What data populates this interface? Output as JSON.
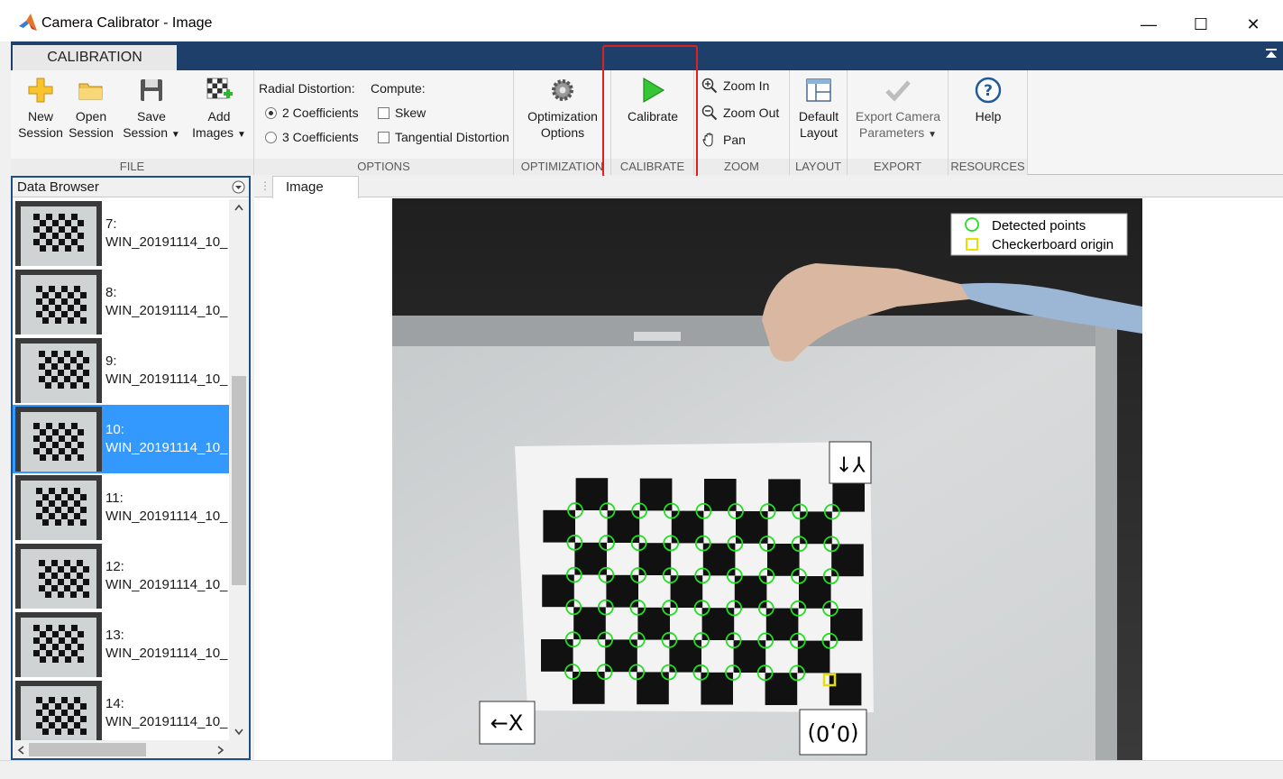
{
  "window": {
    "title": "Camera Calibrator - Image",
    "minimize_glyph": "—",
    "maximize_glyph": "☐",
    "close_glyph": "✕"
  },
  "ribbon": {
    "tab": "CALIBRATION",
    "file": {
      "new_line1": "New",
      "new_line2": "Session",
      "open_line1": "Open",
      "open_line2": "Session",
      "save_line1": "Save",
      "save_line2": "Session",
      "add_line1": "Add",
      "add_line2": "Images",
      "label": "FILE"
    },
    "options": {
      "radial_label": "Radial Distortion:",
      "compute_label": "Compute:",
      "coef2": "2 Coefficients",
      "coef3": "3 Coefficients",
      "coef2_selected": true,
      "skew": "Skew",
      "skew_checked": false,
      "tangential": "Tangential Distortion",
      "tangential_checked": false,
      "label": "OPTIONS"
    },
    "optimization": {
      "line1": "Optimization",
      "line2": "Options",
      "label": "OPTIMIZATION"
    },
    "calibrate": {
      "button": "Calibrate",
      "label": "CALIBRATE"
    },
    "zoom": {
      "zoom_in": "Zoom In",
      "zoom_out": "Zoom Out",
      "pan": "Pan",
      "label": "ZOOM"
    },
    "layout": {
      "line1": "Default",
      "line2": "Layout",
      "label": "LAYOUT"
    },
    "export": {
      "line1": "Export Camera",
      "line2": "Parameters",
      "label": "EXPORT"
    },
    "resources": {
      "help": "Help",
      "label": "RESOURCES"
    }
  },
  "browser": {
    "title": "Data Browser",
    "items": [
      {
        "index": "7:",
        "name": "WIN_20191114_10_",
        "selected": false
      },
      {
        "index": "8:",
        "name": "WIN_20191114_10_",
        "selected": false
      },
      {
        "index": "9:",
        "name": "WIN_20191114_10_",
        "selected": false
      },
      {
        "index": "10:",
        "name": "WIN_20191114_10_",
        "selected": true
      },
      {
        "index": "11:",
        "name": "WIN_20191114_10_",
        "selected": false
      },
      {
        "index": "12:",
        "name": "WIN_20191114_10_",
        "selected": false
      },
      {
        "index": "13:",
        "name": "WIN_20191114_10_",
        "selected": false
      },
      {
        "index": "14:",
        "name": "WIN_20191114_10_",
        "selected": false
      }
    ]
  },
  "image_panel": {
    "tab": "Image",
    "legend_detected": "Detected points",
    "legend_origin": "Checkerboard origin",
    "x_axis_label": "←X",
    "y_axis_label": "Y↑",
    "origin_label": "(0,0)"
  },
  "colors": {
    "ribbon_tab_bg": "#1d3f6a",
    "selection": "#3399ff",
    "detected_point": "#22dd22",
    "origin_marker": "#e8e000",
    "highlight": "#e02020"
  }
}
